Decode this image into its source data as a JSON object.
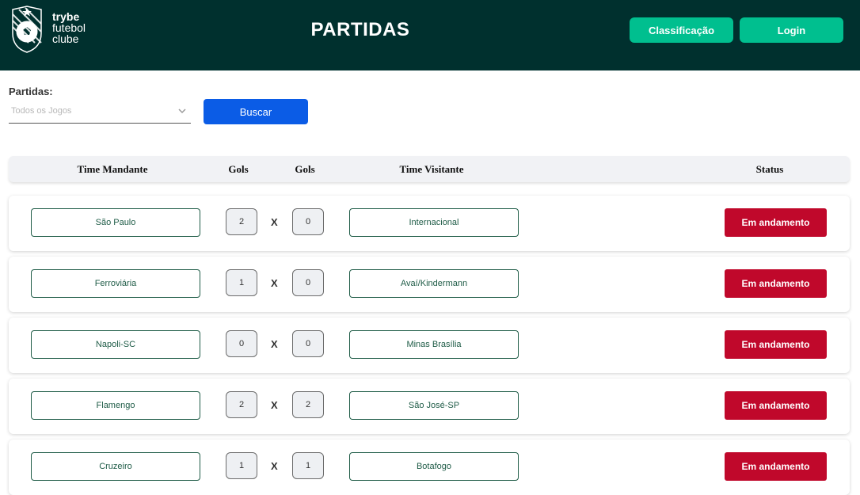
{
  "header": {
    "brand": {
      "line1": "trybe",
      "line2": "futebol",
      "line3": "clube"
    },
    "title": "PARTIDAS",
    "classificacao_label": "Classificação",
    "login_label": "Login",
    "background": "#00302e",
    "accent": "#00bf8f"
  },
  "filter": {
    "label": "Partidas:",
    "select_value": "Todos os Jogos",
    "search_label": "Buscar"
  },
  "table": {
    "columns": [
      "Time Mandante",
      "Gols",
      "Gols",
      "Time Visitante",
      "Status"
    ],
    "rows": [
      {
        "home": "São Paulo",
        "home_goals": "2",
        "vs": "X",
        "away_goals": "0",
        "away": "Internacional",
        "status": "Em andamento"
      },
      {
        "home": "Ferroviária",
        "home_goals": "1",
        "vs": "X",
        "away_goals": "0",
        "away": "Avaí/Kindermann",
        "status": "Em andamento"
      },
      {
        "home": "Napoli-SC",
        "home_goals": "0",
        "vs": "X",
        "away_goals": "0",
        "away": "Minas Brasília",
        "status": "Em andamento"
      },
      {
        "home": "Flamengo",
        "home_goals": "2",
        "vs": "X",
        "away_goals": "2",
        "away": "São José-SP",
        "status": "Em andamento"
      },
      {
        "home": "Cruzeiro",
        "home_goals": "1",
        "vs": "X",
        "away_goals": "1",
        "away": "Botafogo",
        "status": "Em andamento"
      }
    ],
    "status_color": "#c0082b"
  },
  "icons": {
    "logo": "soccer-ball-shield-icon",
    "dropdown": "chevron-down-icon"
  }
}
